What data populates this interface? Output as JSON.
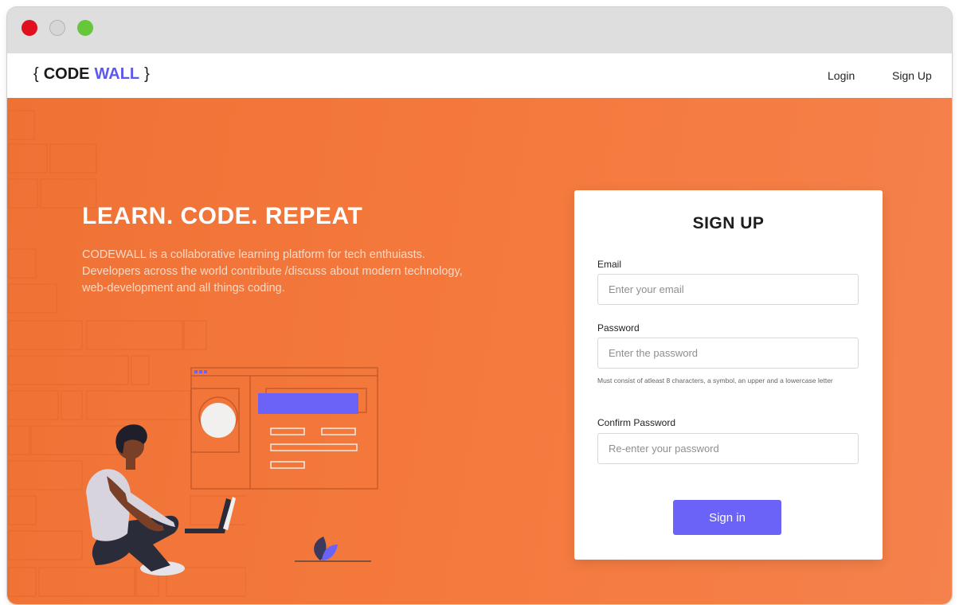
{
  "window": {
    "controls": {
      "close_icon": "close-dot-icon",
      "minimize_icon": "minimize-dot-icon",
      "maximize_icon": "maximize-dot-icon"
    }
  },
  "navbar": {
    "logo": {
      "open_brace": "{",
      "word1": "CODE",
      "word2": "WALL",
      "close_brace": "}"
    },
    "links": {
      "login": "Login",
      "signup": "Sign Up"
    }
  },
  "hero": {
    "headline": "LEARN. CODE. REPEAT",
    "tagline": "CODEWALL is a collaborative learning platform for tech enthuiasts. Developers across the world contribute /discuss about modern technology, web-development and all things coding."
  },
  "signup_form": {
    "title": "SIGN UP",
    "email": {
      "label": "Email",
      "placeholder": "Enter your email",
      "value": ""
    },
    "password": {
      "label": "Password",
      "placeholder": "Enter the password",
      "value": "",
      "hint": "Must consist of atleast 8 characters, a symbol, an upper and a lowercase letter"
    },
    "confirm_password": {
      "label": "Confirm Password",
      "placeholder": "Re-enter your password",
      "value": ""
    },
    "submit_label": "Sign in"
  },
  "colors": {
    "accent": "#6b63f8",
    "logo_accent": "#5e57f2",
    "hero_background": "#f27639",
    "close_dot": "#e0101e",
    "maximize_dot": "#66c73a"
  }
}
